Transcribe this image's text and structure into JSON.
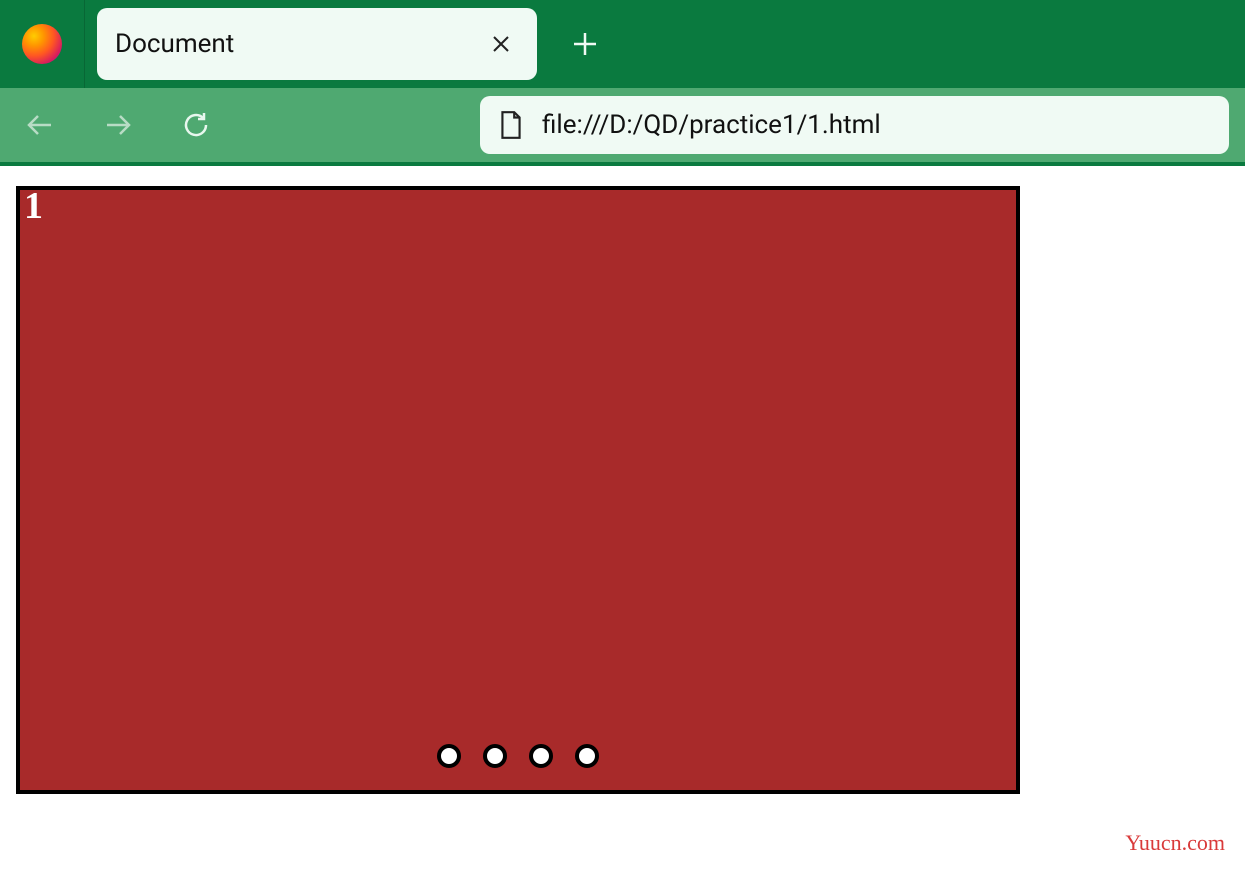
{
  "browser": {
    "tab_title": "Document",
    "url": "file:///D:/QD/practice1/1.html"
  },
  "content": {
    "slide_number": "1",
    "dot_count": 4
  },
  "watermark": "Yuucn.com"
}
